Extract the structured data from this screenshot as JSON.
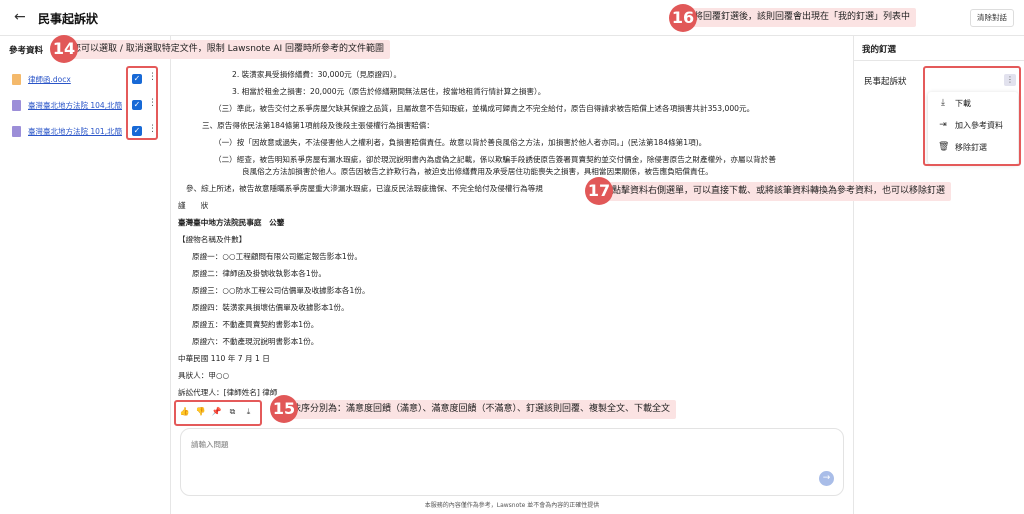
{
  "header": {
    "title": "民事起訴狀",
    "clear_button": "清除對話"
  },
  "references": {
    "header": "參考資料",
    "files": [
      {
        "name": "律師函.docx",
        "type": "docx",
        "checked": true
      },
      {
        "name": "臺灣臺北地方法院 104,北簡...",
        "type": "pdf",
        "checked": true
      },
      {
        "name": "臺灣臺北地方法院 101,北簡...",
        "type": "pdf",
        "checked": true
      }
    ]
  },
  "document": {
    "lines": [
      "2. 裝潢家具受損修繕費：30,000元（見原證四）。",
      "3. 相當於租金之損害：20,000元（原告於修繕期間無法居住，按當地租賃行情計算之損害）。",
      "（三）準此，被告交付之系爭房屋欠缺其保證之品質，且屬故意不告知瑕疵，並構成可歸責之不完全給付，原告自得請求被告賠償上述各項損害共計353,000元。",
      "三、原告得依民法第184條第1項前段及後段主張侵權行為損害賠償：",
      "（一）按「因故意或過失，不法侵害他人之權利者，負損害賠償責任。故意以背於善良風俗之方法，加損害於他人者亦同。」(民法第184條第1項)。",
      "（二）經查，被告明知系爭房屋有漏水瑕疵，卻於現況說明書內為虛偽之記載，係以欺騙手段誘使原告簽署買賣契約並交付價金，除侵害原告之財產權外，亦屬以背於善",
      "良風俗之方法加損害於他人。原告因被告之詐欺行為，被迫支出修繕費用及承受居住功能喪失之損害，具相當因果關係，被告應負賠償責任。",
      "參、綜上所述，被告故意隱瞞系爭房屋重大滲漏水瑕疵，已違反民法瑕疵擔保、不完全給付及侵權行為等規",
      "謹　　狀",
      "臺灣臺中地方法院民事庭　公鑒",
      "【證物名稱及件數】",
      "原證一：○○工程顧問有限公司鑑定報告影本1份。",
      "原證二：律師函及掛號收執影本各1份。",
      "原證三：○○防水工程公司估價單及收據影本各1份。",
      "原證四：裝潢家具損壞估價單及收據影本1份。",
      "原證五：不動產買賣契約書影本1份。",
      "原證六：不動產現況說明書影本1份。",
      "中華民國 110 年 7 月 1 日",
      "具狀人：甲○○",
      "訴訟代理人：[律師姓名] 律師"
    ]
  },
  "actions": [
    {
      "icon": "thumbs-up-icon",
      "glyph": "👍"
    },
    {
      "icon": "thumbs-down-icon",
      "glyph": "👎"
    },
    {
      "icon": "pin-icon",
      "glyph": "📌"
    },
    {
      "icon": "copy-icon",
      "glyph": "⧉"
    },
    {
      "icon": "download-icon",
      "glyph": "⤓"
    }
  ],
  "chat": {
    "placeholder": "請輸入問題",
    "disclaimer": "本服務的內容僅作為參考，Lawsnote 並不會為內容的正確性提供"
  },
  "pinned": {
    "tab": "我的釘選",
    "title": "民事起訴狀",
    "menu": [
      {
        "label": "下載",
        "icon": "download-icon"
      },
      {
        "label": "加入參考資料",
        "icon": "add-reference-icon"
      },
      {
        "label": "移除釘選",
        "icon": "trash-icon"
      }
    ]
  },
  "annotations": {
    "a14": {
      "num": "14",
      "text": "您可以選取 / 取消選取特定文件，限制 Lawsnote AI 回覆時所參考的文件範圍"
    },
    "a15": {
      "num": "15",
      "text": "依序分別為：滿意度回饋（滿意）、滿意度回饋（不滿意）、釘選該則回覆、複製全文、下載全文"
    },
    "a16": {
      "num": "16",
      "text": "將回覆釘選後，該則回覆會出現在「我的釘選」列表中"
    },
    "a17": {
      "num": "17",
      "text": "點擊資料右側選單，可以直接下載、或將該筆資料轉換為參考資料，也可以移除釘選"
    }
  },
  "colors": {
    "accent": "#1769d6",
    "annotation_red": "#e15858",
    "annotation_bg": "#fbe3e3"
  }
}
